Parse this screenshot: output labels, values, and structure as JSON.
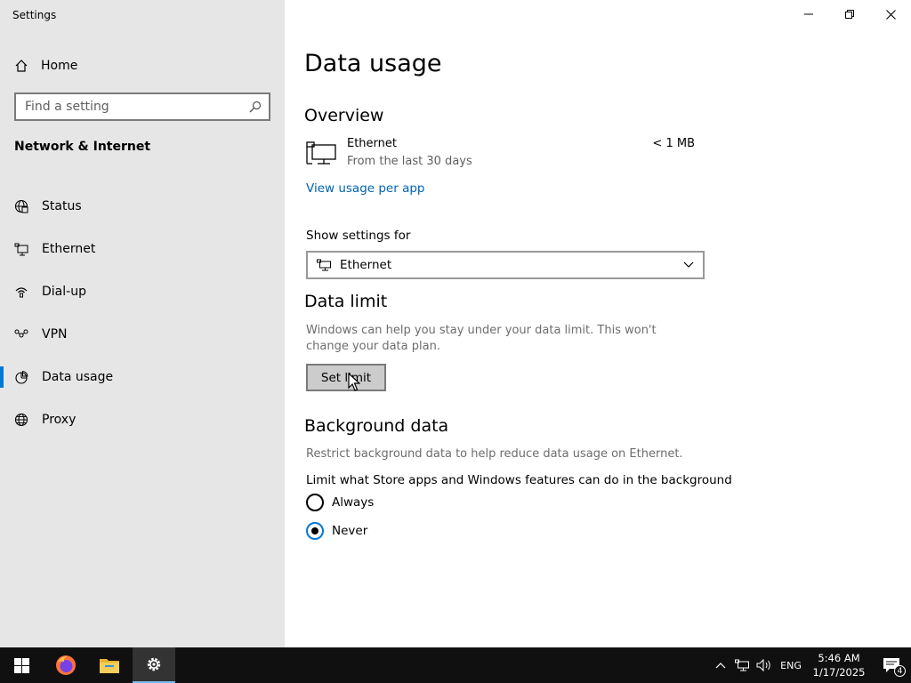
{
  "window": {
    "title": "Settings"
  },
  "sidebar": {
    "home_label": "Home",
    "search_placeholder": "Find a setting",
    "section_title": "Network & Internet",
    "items": [
      {
        "label": "Status",
        "icon": "globe-status-icon"
      },
      {
        "label": "Ethernet",
        "icon": "ethernet-icon"
      },
      {
        "label": "Dial-up",
        "icon": "dialup-icon"
      },
      {
        "label": "VPN",
        "icon": "vpn-icon"
      },
      {
        "label": "Data usage",
        "icon": "data-usage-icon",
        "active": true
      },
      {
        "label": "Proxy",
        "icon": "globe-icon"
      }
    ]
  },
  "main": {
    "title": "Data usage",
    "overview": {
      "heading": "Overview",
      "connection_name": "Ethernet",
      "period": "From the last 30 days",
      "amount": "< 1 MB",
      "link": "View usage per app"
    },
    "show_settings": {
      "label": "Show settings for",
      "selected": "Ethernet"
    },
    "data_limit": {
      "heading": "Data limit",
      "description": "Windows can help you stay under your data limit. This won't change your data plan.",
      "button": "Set limit"
    },
    "background_data": {
      "heading": "Background data",
      "description": "Restrict background data to help reduce data usage on Ethernet.",
      "question": "Limit what Store apps and Windows features can do in the background",
      "options": [
        {
          "label": "Always",
          "checked": false
        },
        {
          "label": "Never",
          "checked": true
        }
      ]
    }
  },
  "taskbar": {
    "language": "ENG",
    "time": "5:46 AM",
    "date": "1/17/2025",
    "notification_count": "4"
  },
  "colors": {
    "sidebar_bg": "#e6e6e6",
    "accent": "#0078d7",
    "link": "#0063b1",
    "taskbar_bg": "#101010"
  }
}
